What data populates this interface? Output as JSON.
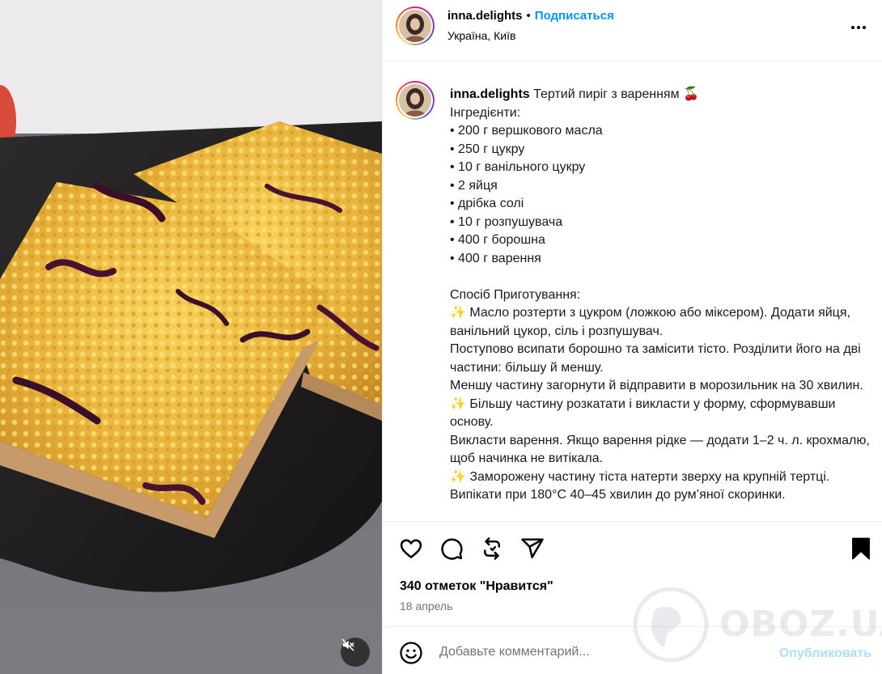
{
  "post": {
    "username": "inna.delights",
    "follow_label": "Подписаться",
    "dot": "•",
    "location": "Україна, Київ",
    "caption": {
      "title": "Тертий пиріг з варенням 🍒",
      "lines": [
        "Інгредієнти:",
        "• 200 г вершкового масла",
        "• 250 г цукру",
        "• 10 г ванільного цукру",
        "• 2 яйця",
        "• дрібка солі",
        "• 10 г розпушувача",
        "• 400 г борошна",
        "• 400 г варення",
        "",
        "Спосіб Приготування:",
        "✨ Масло розтерти з цукром (ложкою або міксером). Додати яйця, ванільний цукор, сіль і розпушувач.",
        "Поступово всипати борошно та замісити тісто. Розділити його на дві частини: більшу й меншу.",
        "Меншу частину загорнути й відправити в морозильник на 30 хвилин.",
        "✨ Більшу частину розкатати і викласти у форму, сформувавши основу.",
        "Викласти варення. Якщо варення рідке — додати 1–2 ч. л. крохмалю, щоб начинка не витікала.",
        "✨ Заморожену частину тіста натерти зверху на крупній тертці.",
        "Випікати при 180°C 40–45 хвилин до рум’яної скоринки."
      ]
    },
    "likes_text": "340 отметок \"Нравится\"",
    "date": "18 апрель"
  },
  "comment": {
    "placeholder": "Добавьте комментарий...",
    "publish_label": "Опубликовать"
  },
  "watermark": {
    "text": "OBOZ.UA"
  },
  "icons": {
    "like": "heart-icon",
    "comment": "comment-bubble-icon",
    "repost": "repost-icon",
    "share": "send-icon",
    "save": "bookmark-icon",
    "more": "more-dots-icon",
    "emoji": "emoji-smile-icon",
    "mute": "muted-speaker-icon"
  },
  "colors": {
    "follow": "#0095f6",
    "publish": "#b3dbff",
    "muted_text": "#737373"
  }
}
